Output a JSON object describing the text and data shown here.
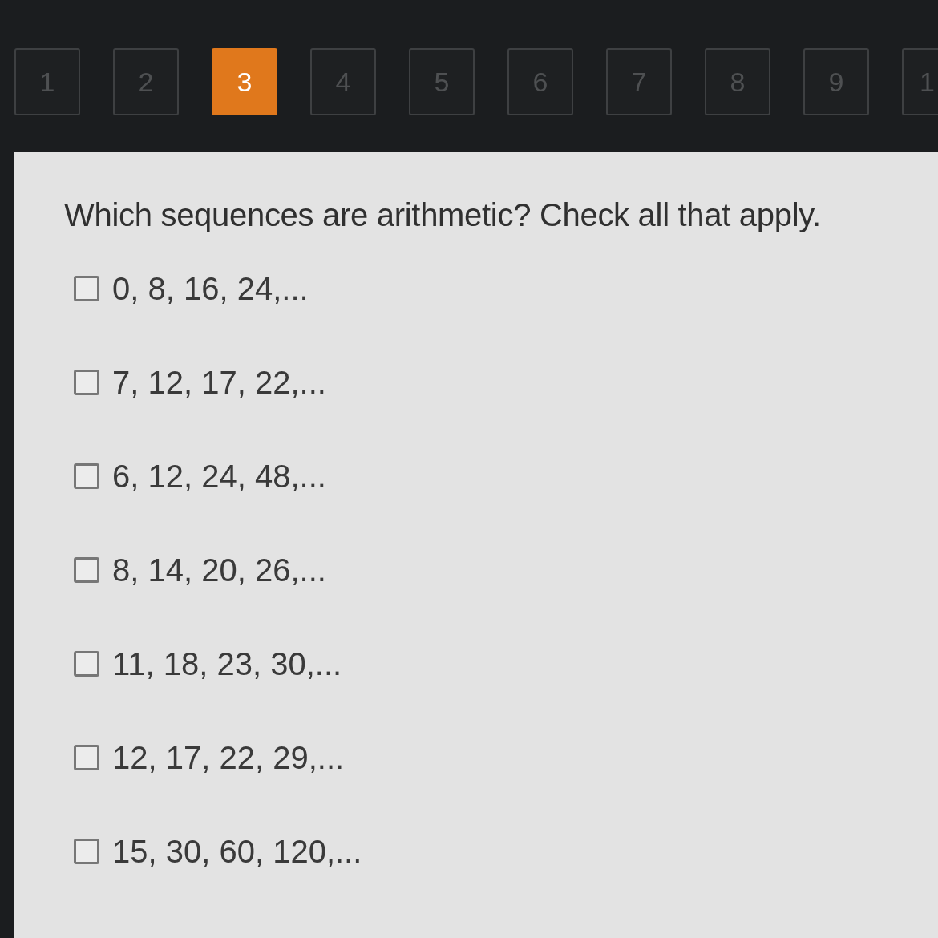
{
  "question_nav": [
    {
      "label": "1",
      "selected": false
    },
    {
      "label": "2",
      "selected": false
    },
    {
      "label": "3",
      "selected": true
    },
    {
      "label": "4",
      "selected": false
    },
    {
      "label": "5",
      "selected": false
    },
    {
      "label": "6",
      "selected": false
    },
    {
      "label": "7",
      "selected": false
    },
    {
      "label": "8",
      "selected": false
    },
    {
      "label": "9",
      "selected": false
    },
    {
      "label": "1",
      "selected": false
    }
  ],
  "question": {
    "prompt": "Which sequences are arithmetic? Check all that apply.",
    "options": [
      {
        "label": "0, 8, 16, 24,...",
        "checked": false
      },
      {
        "label": "7, 12, 17, 22,...",
        "checked": false
      },
      {
        "label": "6, 12, 24, 48,...",
        "checked": false
      },
      {
        "label": "8, 14, 20, 26,...",
        "checked": false
      },
      {
        "label": "11, 18, 23, 30,...",
        "checked": false
      },
      {
        "label": "12, 17, 22, 29,...",
        "checked": false
      },
      {
        "label": "15, 30, 60, 120,...",
        "checked": false
      }
    ]
  }
}
